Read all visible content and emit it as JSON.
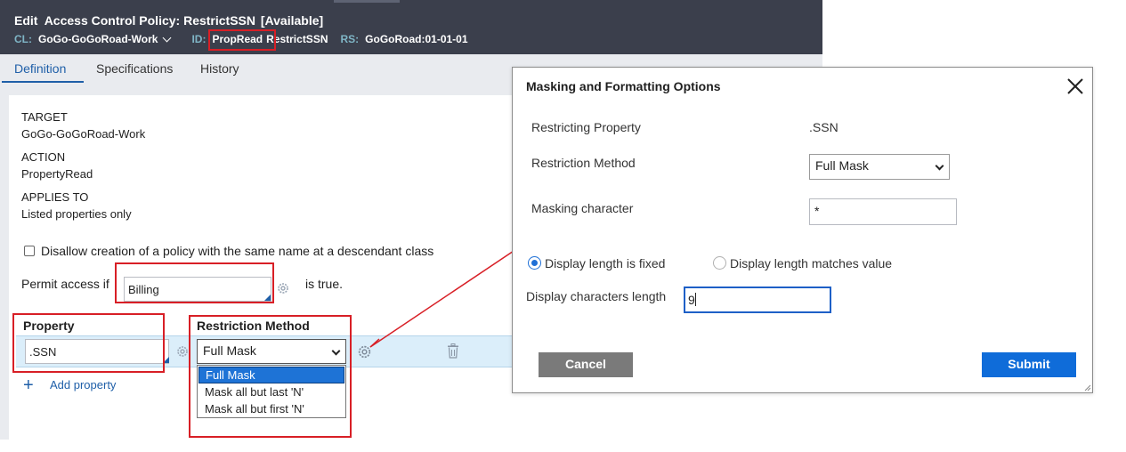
{
  "header": {
    "title": "Edit  Access Control Policy: RestrictSSN",
    "status": "[Available]",
    "cl_label": "CL:",
    "cl_value": "GoGo-GoGoRoad-Work",
    "id_label": "ID:",
    "id_value": "PropRead",
    "id_rule": "RestrictSSN",
    "rs_label": "RS:",
    "rs_value": "GoGoRoad:01-01-01"
  },
  "tabs": [
    "Definition",
    "Specifications",
    "History"
  ],
  "definition": {
    "target_label": "TARGET",
    "target_value": "GoGo-GoGoRoad-Work",
    "action_label": "ACTION",
    "action_value": "PropertyRead",
    "applies_label": "APPLIES TO",
    "applies_value": "Listed properties only",
    "disallow_label": "Disallow creation of a policy with the same name at a descendant class",
    "permit_label": "Permit access if",
    "permit_value": "Billing",
    "permit_suffix": "is true.",
    "property_header": "Property",
    "restriction_header": "Restriction Method",
    "property_value": ".SSN",
    "restriction_value": "Full Mask",
    "dropdown_options": [
      "Full Mask",
      "Mask all but last 'N'",
      "Mask all but first 'N'"
    ],
    "add_property": "Add property"
  },
  "modal": {
    "title": "Masking and Formatting Options",
    "restricting_property_label": "Restricting Property",
    "restricting_property_value": ".SSN",
    "restriction_method_label": "Restriction Method",
    "restriction_method_value": "Full Mask",
    "masking_character_label": "Masking character",
    "masking_character_value": "*",
    "radio_fixed": "Display length is fixed",
    "radio_matches": "Display length matches value",
    "display_chars_label": "Display characters length",
    "display_chars_value": "9",
    "cancel": "Cancel",
    "submit": "Submit"
  },
  "colors": {
    "header_bg": "#3b3f4c",
    "accent": "#1f5fa8",
    "highlight_red": "#d81f26",
    "submit_blue": "#0f6cd9"
  }
}
